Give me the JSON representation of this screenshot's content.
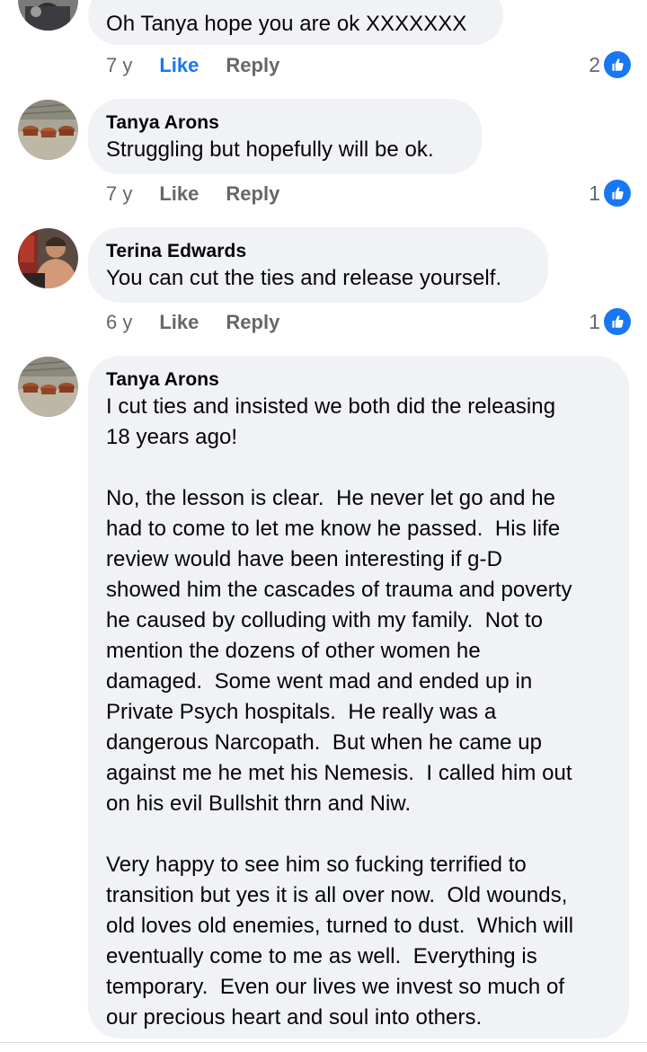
{
  "comments": [
    {
      "author": "",
      "text": "Oh Tanya hope you are ok XXXXXXX",
      "time": "7 y",
      "like_label": "Like",
      "reply_label": "Reply",
      "reaction_count": "2",
      "liked": true
    },
    {
      "author": "Tanya Arons",
      "text": "Struggling but hopefully will be ok.",
      "time": "7 y",
      "like_label": "Like",
      "reply_label": "Reply",
      "reaction_count": "1",
      "liked": false
    },
    {
      "author": "Terina Edwards",
      "text": "You can cut the ties and release yourself.",
      "time": "6 y",
      "like_label": "Like",
      "reply_label": "Reply",
      "reaction_count": "1",
      "liked": false
    },
    {
      "author": "Tanya Arons",
      "text": "I cut ties and insisted we both did the releasing\n18 years ago!\n\nNo, the lesson is clear.  He never let go and he\nhad to come to let me know he passed.  His life\nreview would have been interesting if g-D\nshowed him the cascades of trauma and poverty\nhe caused by colluding with my family.  Not to\nmention the dozens of other women he\ndamaged.  Some went mad and ended up in\nPrivate Psych hospitals.  He really was a\ndangerous Narcopath.  But when he came up\nagainst me he met his Nemesis.  I called him out\non his evil Bullshit thrn and Niw.\n\nVery happy to see him so fucking terrified to\ntransition but yes it is all over now.  Old wounds,\nold loves old enemies, turned to dust.  Which will\neventually come to me as well.  Everything is\ntemporary.  Even our lives we invest so much of\nour precious heart and soul into others."
    }
  ],
  "icons": {
    "reaction": "thumbs-up-icon"
  },
  "colors": {
    "bubble": "#f0f2f5",
    "link_blue": "#1877f2",
    "meta_gray": "#65676b"
  }
}
